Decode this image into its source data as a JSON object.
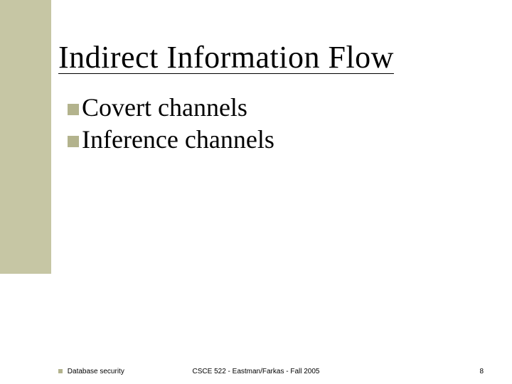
{
  "title": "Indirect Information Flow",
  "bullets": [
    "Covert channels",
    "Inference channels"
  ],
  "footer": {
    "left": "Database security",
    "center": "CSCE 522 - Eastman/Farkas - Fall 2005",
    "page": "8"
  }
}
